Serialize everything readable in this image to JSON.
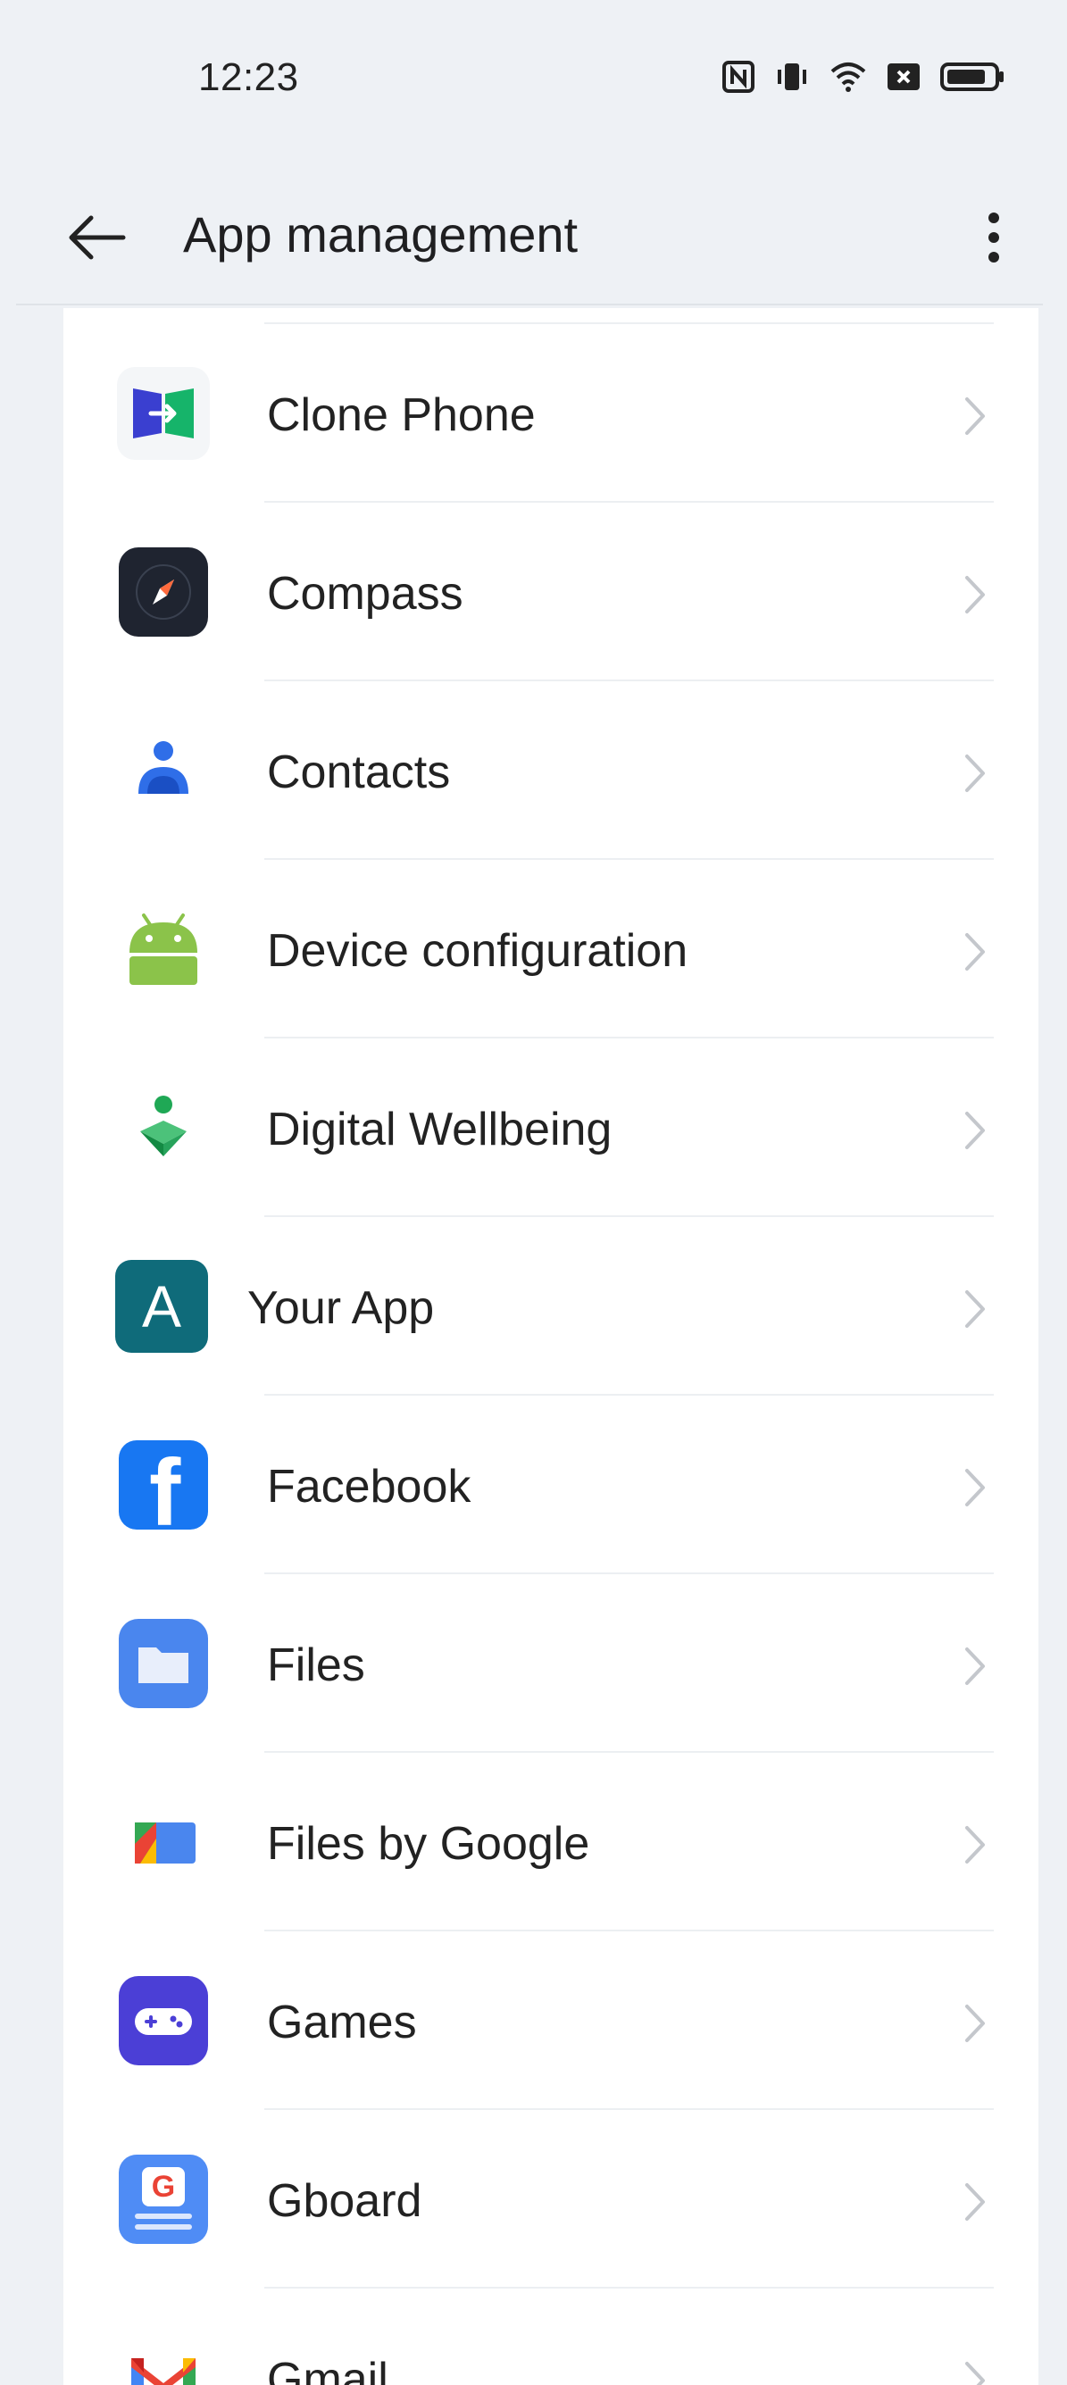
{
  "status_bar": {
    "time": "12:23",
    "icons": [
      "nfc-icon",
      "vibrate-icon",
      "wifi-icon",
      "sim-off-icon",
      "battery-icon"
    ]
  },
  "app_bar": {
    "title": "App management",
    "back_icon": "arrow-left-icon",
    "more_icon": "more-vertical-icon"
  },
  "apps": [
    {
      "label": "Clone Phone",
      "icon": "clone-phone-icon"
    },
    {
      "label": "Compass",
      "icon": "compass-icon"
    },
    {
      "label": "Contacts",
      "icon": "contacts-icon"
    },
    {
      "label": "Device configuration",
      "icon": "android-icon"
    },
    {
      "label": "Digital Wellbeing",
      "icon": "digital-wellbeing-icon"
    },
    {
      "label": "Your App",
      "icon": "your-app-icon",
      "icon_letter": "A"
    },
    {
      "label": "Facebook",
      "icon": "facebook-icon",
      "icon_letter": "f"
    },
    {
      "label": "Files",
      "icon": "files-icon"
    },
    {
      "label": "Files by Google",
      "icon": "files-by-google-icon"
    },
    {
      "label": "Games",
      "icon": "games-icon"
    },
    {
      "label": "Gboard",
      "icon": "gboard-icon",
      "icon_letter": "G"
    },
    {
      "label": "Gmail",
      "icon": "gmail-icon"
    }
  ],
  "colors": {
    "background": "#eef1f5",
    "card": "#ffffff",
    "text": "#222222",
    "chevron": "#c4c7cc",
    "your_app": "#0f6b7a",
    "facebook": "#1877f2",
    "games": "#4b3fd6",
    "files": "#4a86ee",
    "gboard": "#4f8cf5"
  }
}
